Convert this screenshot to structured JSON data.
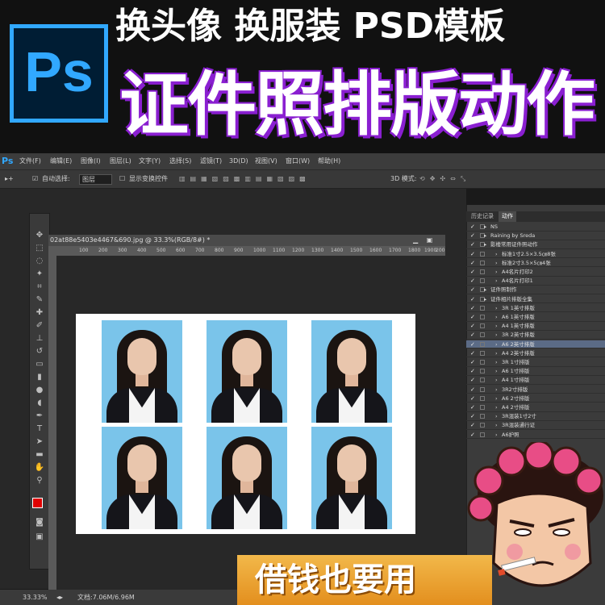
{
  "banner": {
    "logo_text": "Ps",
    "top_title": "换头像 换服装 PSD模板",
    "main_title": "证件照排版动作",
    "bottom_ribbon": "借钱也要用"
  },
  "menubar": {
    "app_icon": "Ps",
    "items": [
      "文件(F)",
      "编辑(E)",
      "图像(I)",
      "图层(L)",
      "文字(Y)",
      "选择(S)",
      "滤镜(T)",
      "3D(D)",
      "视图(V)",
      "窗口(W)",
      "帮助(H)"
    ]
  },
  "options_bar": {
    "auto_select_label": "自动选择:",
    "auto_select_value": "图层",
    "transform_controls_label": "显示变换控件",
    "mode_3d_label": "3D 模式:"
  },
  "document": {
    "tab_title": "02at88e5403e4467&690.jpg @ 33.3%(RGB/8#) *",
    "ruler_ticks": [
      "100",
      "200",
      "300",
      "400",
      "500",
      "600",
      "700",
      "800",
      "900",
      "1000",
      "1100",
      "1200",
      "1300",
      "1400",
      "1500",
      "1600",
      "1700",
      "1800",
      "1900",
      "2000"
    ]
  },
  "status_bar": {
    "zoom": "33.33%",
    "doc_size": "文档:7.06M/6.96M"
  },
  "panel": {
    "tabs": [
      "历史记录",
      "动作"
    ],
    "active_tab": "动作",
    "actions": [
      {
        "label": "NS",
        "indent": 2,
        "selected": false
      },
      {
        "label": "Raining by Sreda",
        "indent": 2,
        "selected": false
      },
      {
        "label": "影楼常用证件照动作",
        "indent": 2,
        "selected": false
      },
      {
        "label": "标准1寸2.5×3.5㎝8张",
        "indent": 3,
        "selected": false
      },
      {
        "label": "标准2寸3.5×5㎝4张",
        "indent": 3,
        "selected": false
      },
      {
        "label": "A4名片打印2",
        "indent": 3,
        "selected": false
      },
      {
        "label": "A4名片打印1",
        "indent": 3,
        "selected": false
      },
      {
        "label": "证件照制作",
        "indent": 2,
        "selected": false
      },
      {
        "label": "证件相片排版全集",
        "indent": 2,
        "selected": false
      },
      {
        "label": "3R 1英寸排版",
        "indent": 3,
        "selected": false
      },
      {
        "label": "A6 1英寸排版",
        "indent": 3,
        "selected": false
      },
      {
        "label": "A4 1英寸排版",
        "indent": 3,
        "selected": false
      },
      {
        "label": "3R 2英寸排版",
        "indent": 3,
        "selected": false
      },
      {
        "label": "A6 2英寸排版",
        "indent": 3,
        "selected": true
      },
      {
        "label": "A4 2英寸排版",
        "indent": 3,
        "selected": false
      },
      {
        "label": "3R 1寸排版",
        "indent": 3,
        "selected": false
      },
      {
        "label": "A6 1寸排版",
        "indent": 3,
        "selected": false
      },
      {
        "label": "A4 1寸排版",
        "indent": 3,
        "selected": false
      },
      {
        "label": "3R2寸排版",
        "indent": 3,
        "selected": false
      },
      {
        "label": "A6 2寸排版",
        "indent": 3,
        "selected": false
      },
      {
        "label": "A4 2寸排版",
        "indent": 3,
        "selected": false
      },
      {
        "label": "3R混装1寸2寸",
        "indent": 3,
        "selected": false
      },
      {
        "label": "3R混装通行证",
        "indent": 3,
        "selected": false
      },
      {
        "label": "A6护照",
        "indent": 3,
        "selected": false
      }
    ]
  },
  "colors": {
    "ps_blue": "#31a8ff",
    "ps_dark": "#001d34",
    "title_shadow": "#8a1fd1",
    "ribbon": "#e9a033",
    "selection": "#5b6b86"
  }
}
